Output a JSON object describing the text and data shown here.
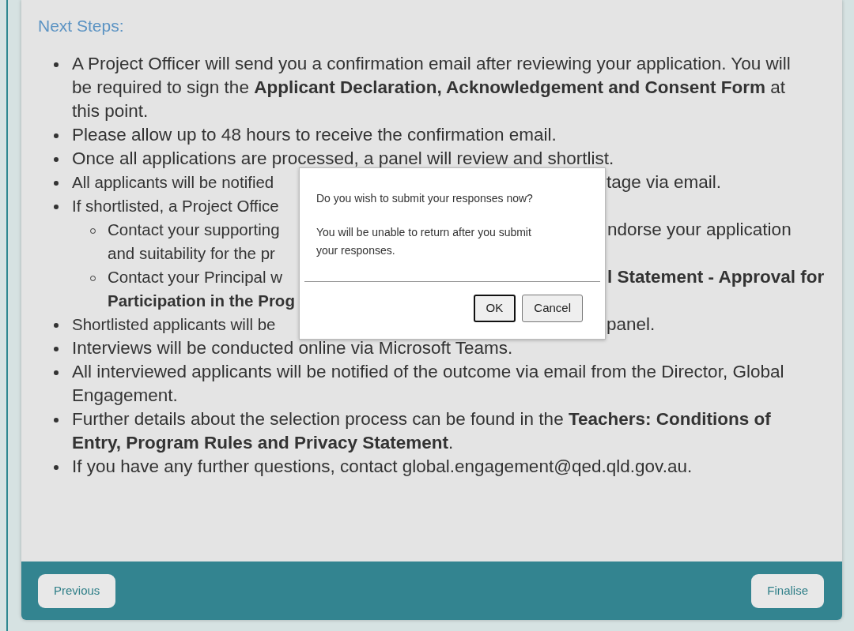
{
  "heading": "Next Steps:",
  "steps": [
    {
      "text": "A Project Officer will send you a confirmation email after reviewing your application. You will be required to sign the **Applicant Declaration, Acknowledgement and Consent Form** at this point."
    },
    {
      "text": "Please allow up to 48 hours to receive the confirmation email."
    },
    {
      "text": "Once all applications are processed, a panel will review and shortlist."
    },
    {
      "segments": [
        {
          "left": "All applicants will be notified",
          "right": "tage via email."
        }
      ]
    },
    {
      "segments": [
        {
          "left": "If shortlisted, a Project Office"
        }
      ],
      "children": [
        {
          "segments": [
            {
              "left": "Contact your supporting",
              "right": "ndorse your application"
            },
            {
              "left": "and suitability for the pr"
            }
          ]
        },
        {
          "segments": [
            {
              "left": "Contact your Principal w",
              "right": "**l Statement - Approval for**"
            },
            {
              "left": "**Participation in the Prog**"
            }
          ]
        }
      ]
    },
    {
      "segments": [
        {
          "left": "Shortlisted applicants will be",
          "right": "panel."
        }
      ]
    },
    {
      "text": "Interviews will be conducted online via Microsoft Teams."
    },
    {
      "text": "All interviewed applicants will be notified of the outcome via email from the Director, Global Engagement."
    },
    {
      "text": "Further details about the selection process can be found in the **Teachers: Conditions of Entry, Program Rules and Privacy Statement**."
    },
    {
      "text": "If you have any further questions, contact global.engagement@qed.qld.gov.au."
    }
  ],
  "footer": {
    "buttons": [
      "Previous",
      "Finalise"
    ]
  },
  "dialog": {
    "question": "Do you wish to submit your responses now?",
    "message": "You will be unable to return after you submit your responses.",
    "buttons": [
      {
        "label": "OK",
        "selected": true
      },
      {
        "label": "Cancel",
        "selected": false
      }
    ]
  }
}
